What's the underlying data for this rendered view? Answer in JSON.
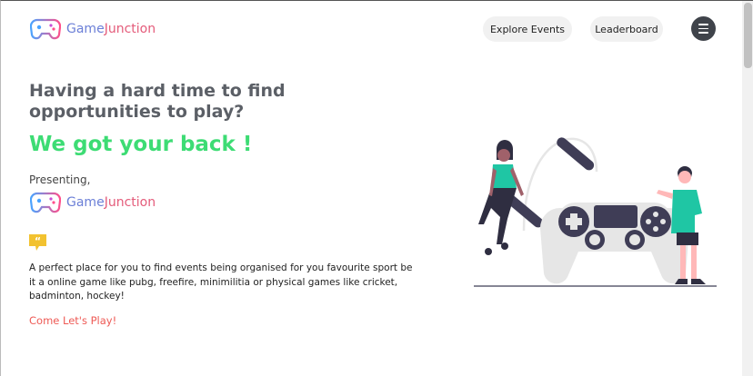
{
  "brand": {
    "name_part1": "Game",
    "name_part2": "Junction"
  },
  "nav": {
    "explore_label": "Explore Events",
    "leaderboard_label": "Leaderboard",
    "menu_icon": "hamburger-icon"
  },
  "hero": {
    "headline": "Having a hard time to find opportunities to play?",
    "tagline": "We got your back !",
    "presenting_label": "Presenting,",
    "quote_icon": "quote-icon",
    "description": "A perfect place for you to find events being organised for you favourite sport be it a online game like pubg, freefire, minimilitia or physical games like cricket, badminton, hockey!",
    "cta_label": "Come Let's Play!"
  },
  "colors": {
    "accent_green": "#3ddc74",
    "cta_red": "#ee5a55",
    "teal": "#1fc6a4",
    "brand_blue": "#6b7fd7",
    "brand_pink": "#e45b7a"
  }
}
